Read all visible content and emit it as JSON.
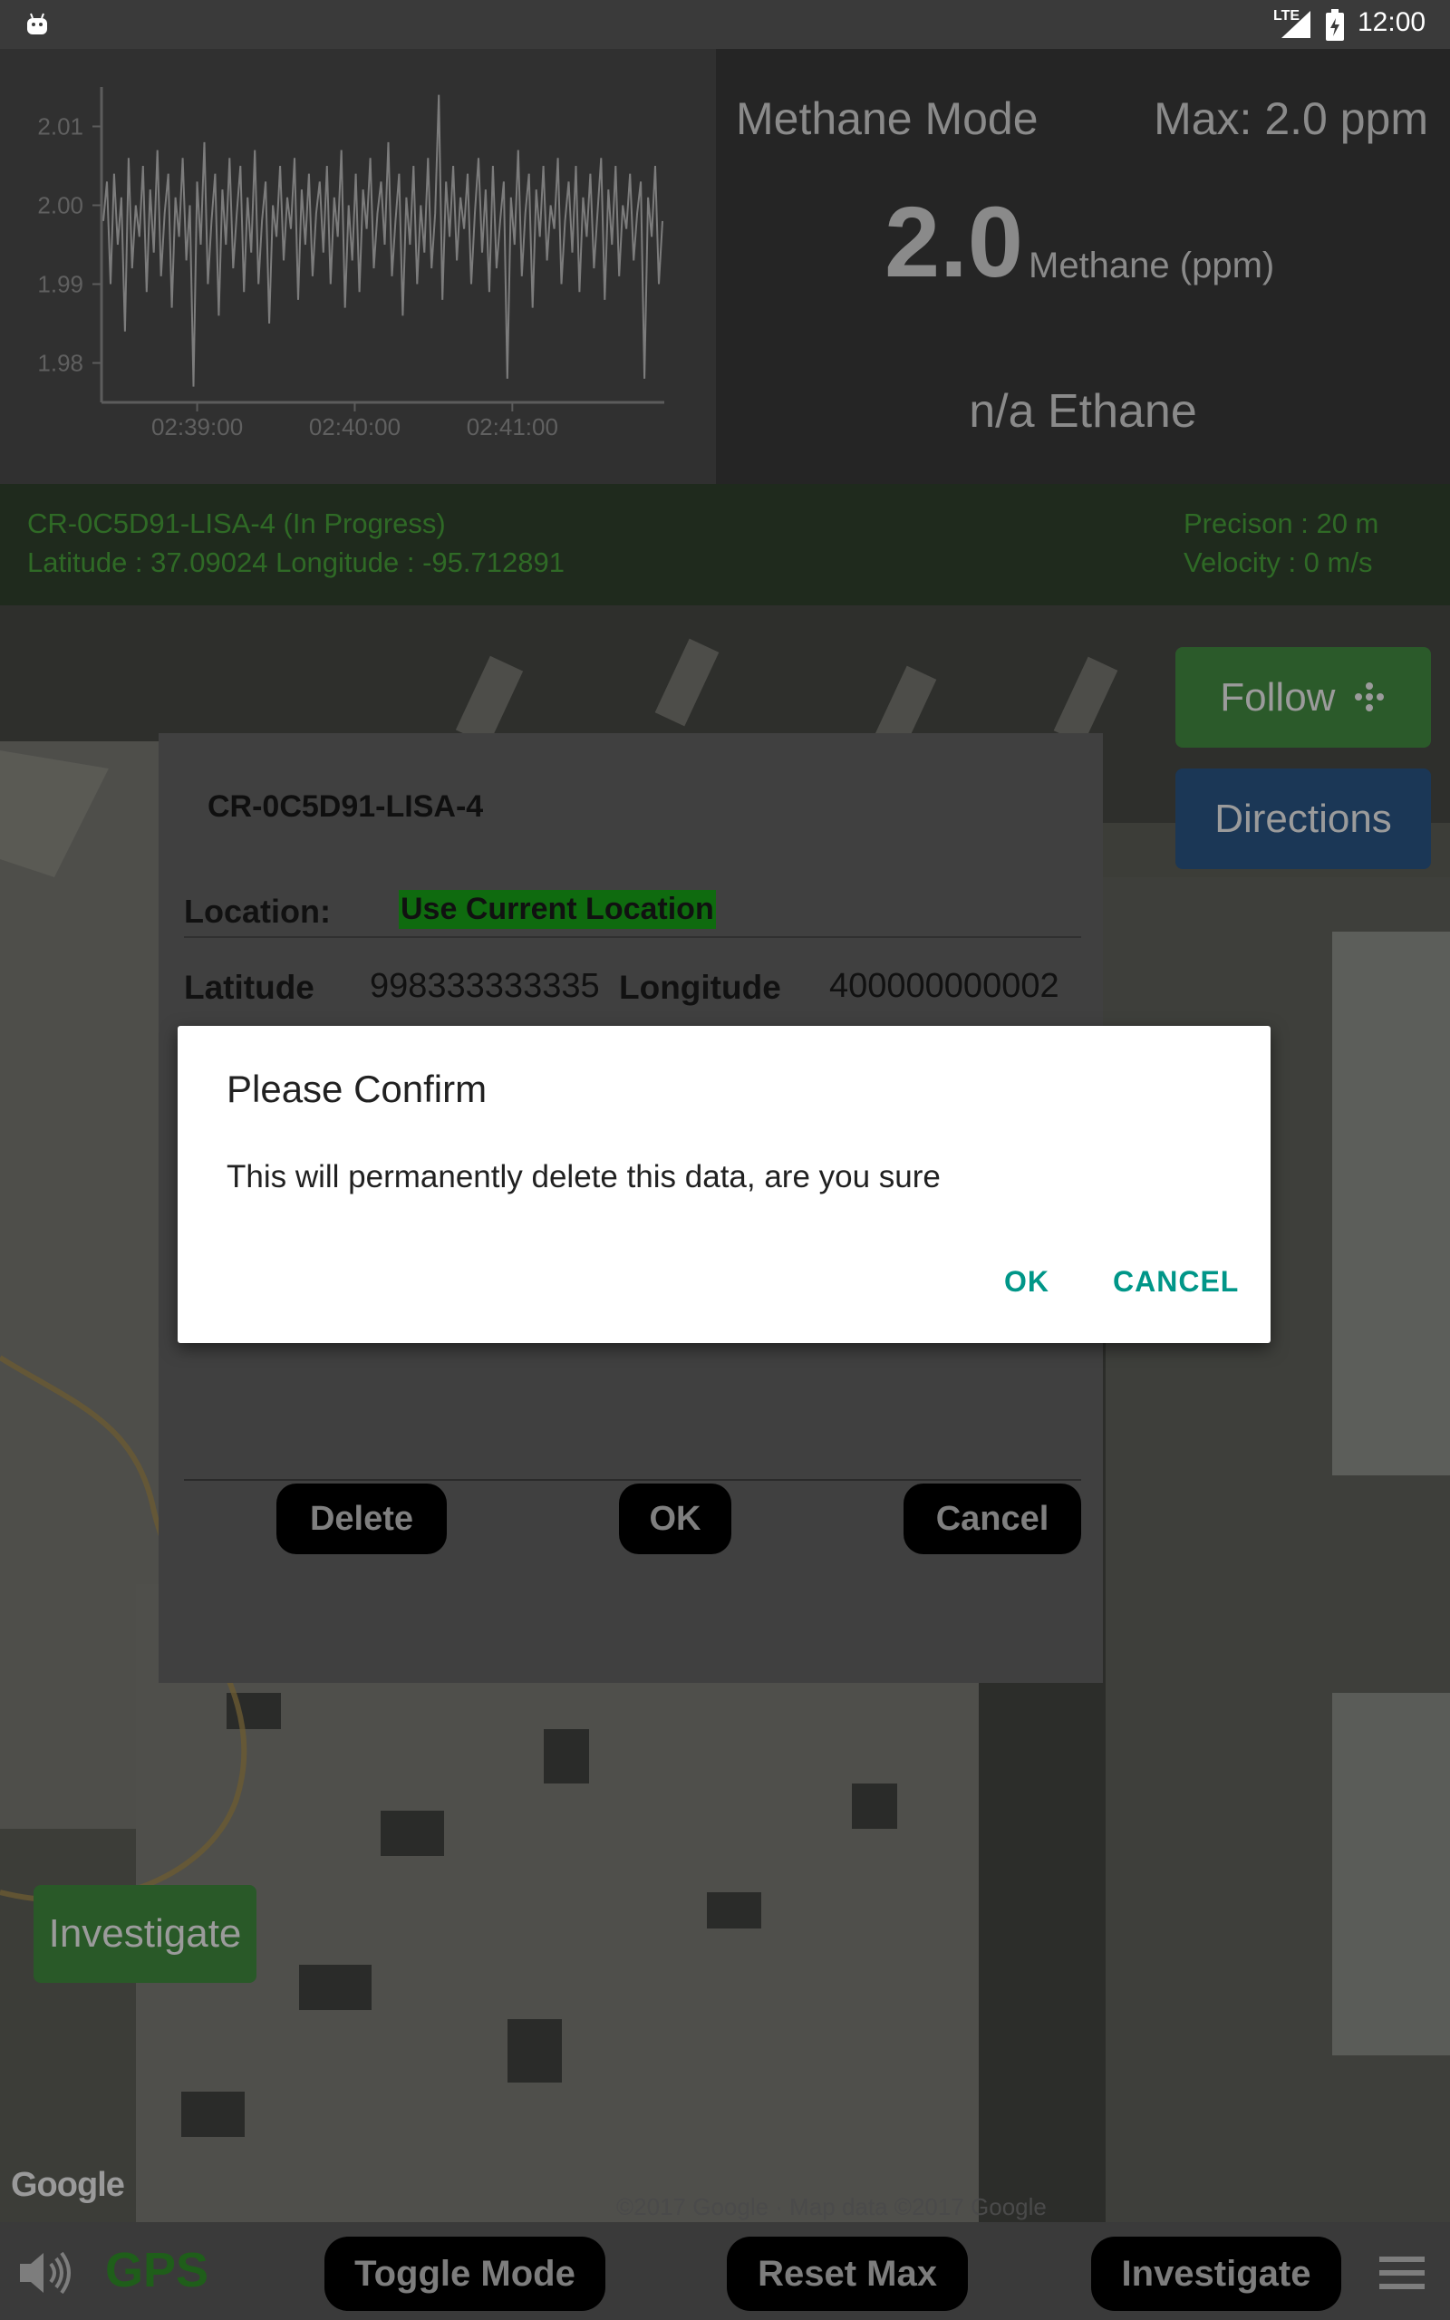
{
  "status_bar": {
    "network": "LTE",
    "time": "12:00"
  },
  "chart_data": {
    "type": "line",
    "x_ticks": [
      "02:39:00",
      "02:40:00",
      "02:41:00"
    ],
    "y_ticks": [
      "2.01",
      "2.00",
      "1.99",
      "1.98"
    ],
    "ylim": [
      1.975,
      2.015
    ],
    "series": [
      {
        "values": [
          1.998,
          2.003,
          1.99,
          2.004,
          1.995,
          2.001,
          1.984,
          2.006,
          1.992,
          2.0,
          1.996,
          2.005,
          1.989,
          2.002,
          1.994,
          2.007,
          1.991,
          1.999,
          2.004,
          1.987,
          2.001,
          1.996,
          2.006,
          1.993,
          2.0,
          1.977,
          2.003,
          1.995,
          2.008,
          1.99,
          1.998,
          2.004,
          1.986,
          2.002,
          1.995,
          2.006,
          1.992,
          1.999,
          2.005,
          1.989,
          2.001,
          1.994,
          2.007,
          1.99,
          1.998,
          2.003,
          1.985,
          2.0,
          1.996,
          2.005,
          1.993,
          2.001,
          1.997,
          2.006,
          1.988,
          2.002,
          1.995,
          2.004,
          1.991,
          1.999,
          2.003,
          1.994,
          2.005,
          1.99,
          2.001,
          1.996,
          2.007,
          1.987,
          2.0,
          1.993,
          2.004,
          1.989,
          2.002,
          1.997,
          2.006,
          1.992,
          1.999,
          2.003,
          1.995,
          2.008,
          1.991,
          1.998,
          2.004,
          1.986,
          2.001,
          1.995,
          2.005,
          1.99,
          2.0,
          1.994,
          2.006,
          1.992,
          1.999,
          2.014,
          1.988,
          2.003,
          1.996,
          2.005,
          1.993,
          2.001,
          1.997,
          2.004,
          1.99,
          1.999,
          2.006,
          1.994,
          2.002,
          1.989,
          2.005,
          1.992,
          1.998,
          2.003,
          1.978,
          2.001,
          1.995,
          2.007,
          1.991,
          1.999,
          2.004,
          1.987,
          2.002,
          1.996,
          2.005,
          1.993,
          2.0,
          1.997,
          2.006,
          1.99,
          1.998,
          2.003,
          1.994,
          2.005,
          1.989,
          2.001,
          1.996,
          2.004,
          1.992,
          1.999,
          2.006,
          1.988,
          2.002,
          1.995,
          2.005,
          1.991,
          2.0,
          1.997,
          2.004,
          1.993,
          1.999,
          2.003,
          1.978,
          2.001,
          1.996,
          2.005,
          1.99,
          1.998
        ]
      }
    ]
  },
  "readout": {
    "mode": "Methane Mode",
    "max": "Max: 2.0 ppm",
    "methane_value": "2.0",
    "methane_unit": "Methane (ppm)",
    "ethane": "n/a Ethane"
  },
  "info": {
    "survey": "CR-0C5D91-LISA-4  (In Progress)",
    "latlon": "Latitude : 37.09024  Longitude  :  -95.712891",
    "precision": "Precison : 20  m",
    "velocity": "Velocity : 0  m/s"
  },
  "map": {
    "follow_label": "Follow",
    "directions_label": "Directions",
    "investigate_label": "Investigate",
    "google_logo": "Google",
    "credit": "©2017 Google · Map data ©2017 Google"
  },
  "edit_dialog": {
    "title": "CR-0C5D91-LISA-4",
    "location_label": "Location:",
    "location_value": "Use Current Location",
    "latitude_label": "Latitude",
    "latitude_value": "998333333335",
    "longitude_label": "Longitude",
    "longitude_value": "400000000002",
    "delete_label": "Delete",
    "ok_label": "OK",
    "cancel_label": "Cancel"
  },
  "confirm_dialog": {
    "title": "Please Confirm",
    "message": "This will permanently delete this data, are you sure",
    "ok_label": "OK",
    "cancel_label": "CANCEL",
    "accent": "#009688"
  },
  "bottom_bar": {
    "gps_label": "GPS",
    "toggle_label": "Toggle Mode",
    "reset_label": "Reset Max",
    "investigate_label": "Investigate"
  }
}
